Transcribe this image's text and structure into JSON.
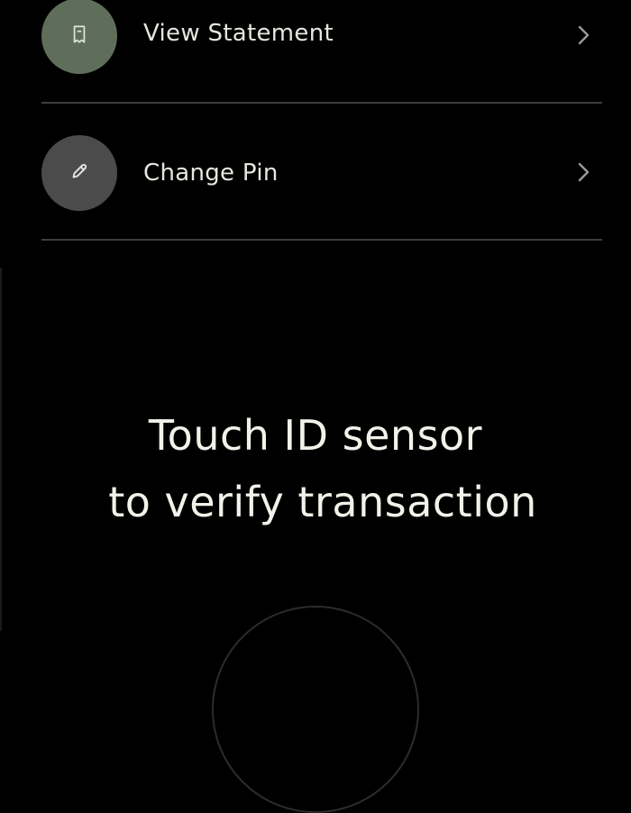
{
  "menu": {
    "items": [
      {
        "label": "View Statement",
        "icon": "receipt-icon",
        "icon_bg": "#5e6e5a",
        "chevron_icon": "chevron-right-icon"
      },
      {
        "label": "Change Pin",
        "icon": "pencil-icon",
        "icon_bg": "#4b4b4b",
        "chevron_icon": "chevron-right-icon"
      }
    ]
  },
  "prompt": {
    "line1": "Touch ID sensor",
    "line2": "to verify transaction"
  },
  "sensor": {
    "icon": "fingerprint-sensor-ring"
  },
  "colors": {
    "background": "#000000",
    "text": "#e8e8e2",
    "divider": "#3e3e3e",
    "chevron": "#9a9a9a"
  }
}
